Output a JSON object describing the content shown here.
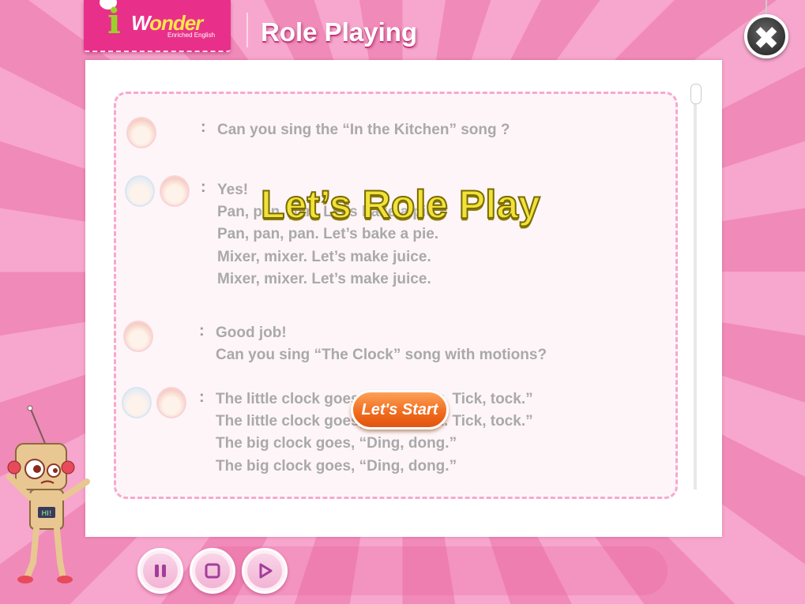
{
  "header": {
    "logo_i": "i",
    "logo_w": "W",
    "logo_on": "onder",
    "logo_subtitle": "Enriched English",
    "title": "Role Playing",
    "close_icon": "✖"
  },
  "dialog": [
    {
      "speakers": [
        "girl-icon"
      ],
      "lines": [
        "Can you sing the “In the Kitchen” song ?"
      ]
    },
    {
      "speakers": [
        "boy-icon",
        "girl-icon"
      ],
      "lines": [
        "Yes!",
        "Pan, pan, pan. Let’s bake a pie.",
        "Pan, pan, pan. Let’s bake a pie.",
        "Mixer, mixer. Let’s make juice.",
        "Mixer, mixer. Let’s make juice."
      ]
    },
    {
      "speakers": [
        "girl-icon"
      ],
      "lines": [
        "Good job!",
        "Can you sing “The Clock” song with motions?"
      ]
    },
    {
      "speakers": [
        "boy-icon",
        "girl-icon"
      ],
      "lines": [
        "The little clock goes, “Tick, tock. Tick, tock.”",
        "The little clock goes, “Tick, tock. Tick, tock.”",
        "The big clock goes, “Ding, dong.”",
        "The big clock goes, “Ding, dong.”"
      ]
    }
  ],
  "overlay": {
    "title": "Let’s Role Play",
    "start_label": "Let's Start"
  },
  "robot": {
    "badge": "HI!"
  },
  "controls": {
    "pause_icon": "pause-icon",
    "stop_icon": "stop-icon",
    "play_icon": "play-icon",
    "accent_color": "#a23e9a"
  }
}
